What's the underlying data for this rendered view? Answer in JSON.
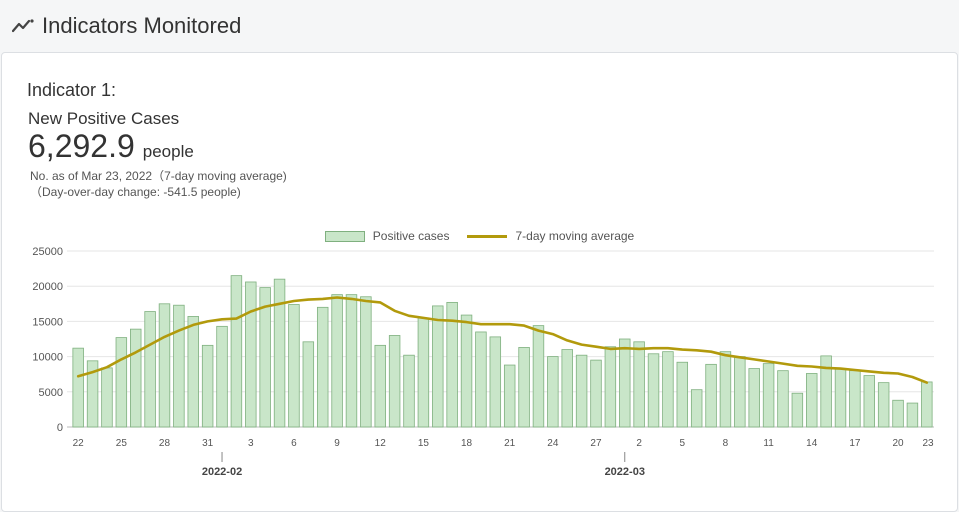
{
  "header": {
    "title": "Indicators Monitored",
    "icon": "trend-line-icon"
  },
  "indicator": {
    "label": "Indicator 1:",
    "name": "New Positive Cases",
    "value": "6,292.9",
    "unit": "people",
    "as_of": "No. as of Mar 23, 2022（7-day moving average)",
    "change": "（Day-over-day change: -541.5 people)"
  },
  "colors": {
    "bar_fill": "#c9e6c9",
    "bar_stroke": "#7fb07f",
    "line": "#b29a0c"
  },
  "chart_data": {
    "type": "bar",
    "legend": [
      "Positive cases",
      "7-day moving average"
    ],
    "ylim": [
      0,
      25000
    ],
    "yticks": [
      0,
      5000,
      10000,
      15000,
      20000,
      25000
    ],
    "x_tick_labels": [
      "22",
      "25",
      "28",
      "31",
      "3",
      "6",
      "9",
      "12",
      "15",
      "18",
      "21",
      "24",
      "27",
      "2",
      "5",
      "8",
      "11",
      "14",
      "17",
      "20",
      "23"
    ],
    "month_labels": [
      "2022-02",
      "2022-03"
    ],
    "start_date": "2022-01-22",
    "series": [
      {
        "name": "Positive cases",
        "type": "bar",
        "values": [
          11200,
          9400,
          8400,
          12700,
          13900,
          16400,
          17500,
          17300,
          15700,
          11600,
          14300,
          21500,
          20600,
          19800,
          21000,
          17400,
          12100,
          17000,
          18800,
          18800,
          18500,
          11600,
          13000,
          10200,
          15500,
          17200,
          17700,
          15900,
          13500,
          12800,
          8800,
          11300,
          14400,
          10000,
          11000,
          10200,
          9500,
          11400,
          12500,
          12100,
          10400,
          10700,
          9200,
          5300,
          8900,
          10700,
          10000,
          8300,
          9000,
          8000,
          4800,
          7600,
          10100,
          8300,
          8000,
          7300,
          6300,
          3800,
          3400,
          6400
        ]
      },
      {
        "name": "7-day moving average",
        "type": "line",
        "values": [
          7200,
          7800,
          8500,
          9600,
          10600,
          11700,
          12800,
          13700,
          14500,
          15000,
          15300,
          15400,
          16400,
          17100,
          17500,
          17900,
          18100,
          18200,
          18400,
          18200,
          17900,
          17700,
          16500,
          15800,
          15500,
          15200,
          15100,
          14900,
          14600,
          14600,
          14600,
          14400,
          13700,
          13200,
          12300,
          11700,
          11400,
          11100,
          11200,
          11100,
          11200,
          11200,
          11000,
          10900,
          10700,
          10200,
          9900,
          9600,
          9300,
          9000,
          8700,
          8600,
          8400,
          8300,
          8100,
          7900,
          7700,
          7600,
          7100,
          6300
        ]
      }
    ]
  }
}
